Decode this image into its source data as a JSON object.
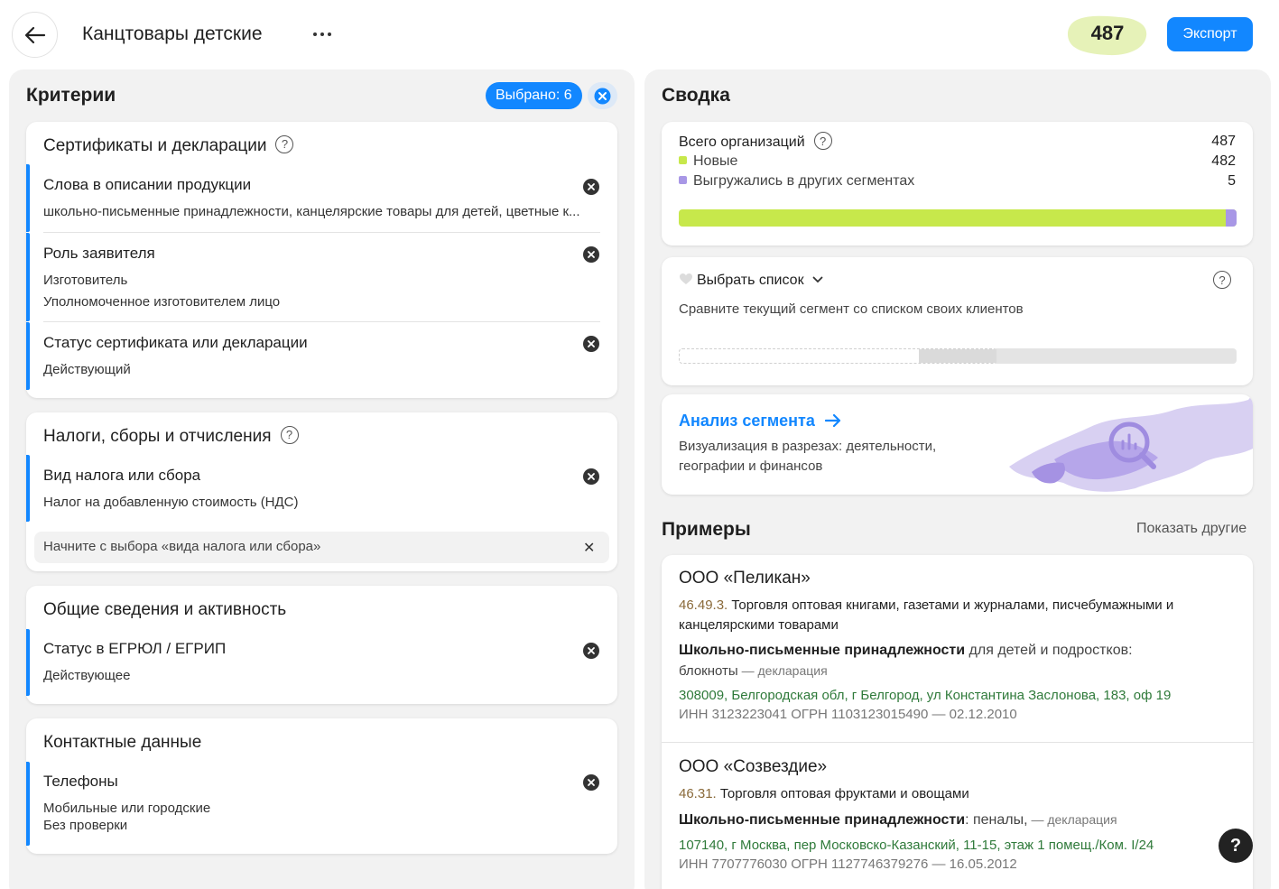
{
  "header": {
    "title": "Канцтовары детские",
    "count": "487",
    "export_label": "Экспорт",
    "back_icon": "arrow-left-icon",
    "more_icon": "ellipsis-icon",
    "colors": {
      "accent": "#1287ff",
      "count_blob": "#e6f2b8"
    }
  },
  "criteria": {
    "title": "Критерии",
    "selected_label": "Выбрано: 6",
    "groups": [
      {
        "title": "Сертификаты и декларации",
        "items": [
          {
            "name": "Слова в описании продукции",
            "values": [
              "школьно-письменные принадлежности, канцелярские товары для детей, цветные к..."
            ]
          },
          {
            "name": "Роль заявителя",
            "values": [
              "Изготовитель",
              "Уполномоченное изготовителем лицо"
            ]
          },
          {
            "name": "Статус сертификата или декларации",
            "values": [
              "Действующий"
            ]
          }
        ]
      },
      {
        "title": "Налоги, сборы и отчисления",
        "items": [
          {
            "name": "Вид налога или сбора",
            "values": [
              "Налог на добавленную стоимость (НДС)"
            ]
          }
        ],
        "input_placeholder": "Начните с выбора «вида налога или сбора»"
      },
      {
        "title": "Общие сведения и активность",
        "items": [
          {
            "name": "Статус в ЕГРЮЛ / ЕГРИП",
            "values": [
              "Действующее"
            ]
          }
        ]
      },
      {
        "title": "Контактные данные",
        "items": [
          {
            "name": "Телефоны",
            "values": [
              "Мобильные или городские",
              "Без проверки"
            ]
          }
        ]
      }
    ]
  },
  "summary": {
    "title": "Сводка",
    "total_label": "Всего организаций",
    "total_value": "487",
    "new_label": "Новые",
    "new_value": "482",
    "exported_label": "Выгружались в других сегментах",
    "exported_value": "5",
    "progress_new_fraction": 0.98,
    "colors": {
      "new": "#c7e84b",
      "exported": "#a897e6"
    },
    "compare": {
      "label": "Выбрать список",
      "description": "Сравните текущий сегмент со списком своих клиентов"
    },
    "analysis": {
      "title": "Анализ сегмента",
      "description_line1": "Визуализация в разрезах: деятельности,",
      "description_line2": "географии и финансов"
    }
  },
  "examples": {
    "title": "Примеры",
    "show_more": "Показать другие",
    "items": [
      {
        "name": "ООО «Пеликан»",
        "okved_code": "46.49.3.",
        "okved_line1": " Торговля оптовая книгами, газетами и журналами, писчебумажными и",
        "okved_line2": "канцелярскими товарами",
        "product_bold": "Школьно-письменные принадлежности",
        "product_rest": " для детей и подростков:",
        "product_line2": "блокноты",
        "doc_type": " — декларация",
        "address": "308009, Белгородская обл, г Белгород, ул Константина Заслонова, 183, оф 19",
        "ids": "ИНН 3123223041   ОГРН 1103123015490 — 02.12.2010"
      },
      {
        "name": "ООО «Созвездие»",
        "okved_code": "46.31.",
        "okved_line1": " Торговля оптовая фруктами и овощами",
        "product_bold": "Школьно-письменные принадлежности",
        "product_rest": ": пеналы,",
        "doc_type": " — декларация",
        "address": "107140, г Москва, пер Московско-Казанский, 11-15, этаж 1 помещ./Ком. I/24",
        "ids": "ИНН 7707776030   ОГРН 1127746379276 — 16.05.2012"
      }
    ]
  },
  "help_fab_label": "?"
}
